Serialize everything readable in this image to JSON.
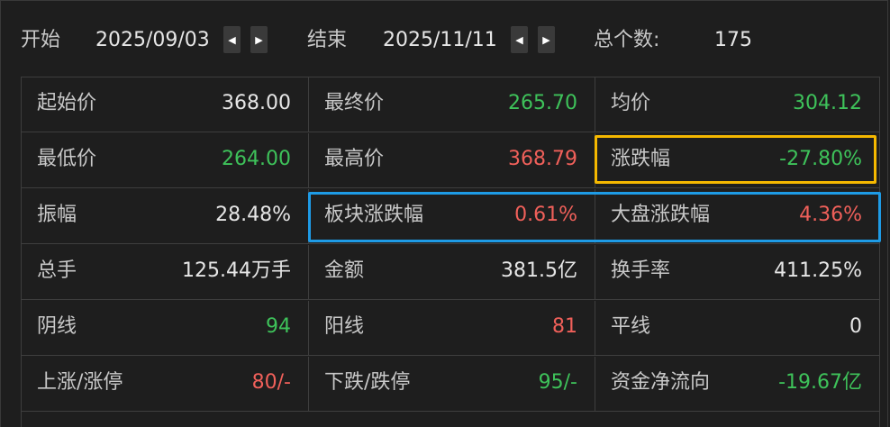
{
  "header": {
    "start_label": "开始",
    "start_date": "2025/09/03",
    "end_label": "结束",
    "end_date": "2025/11/11",
    "count_label": "总个数:",
    "count_value": "175",
    "prev_glyph": "◀",
    "next_glyph": "▶"
  },
  "stats": [
    [
      {
        "label": "起始价",
        "value": "368.00",
        "color": "white"
      },
      {
        "label": "最终价",
        "value": "265.70",
        "color": "green"
      },
      {
        "label": "均价",
        "value": "304.12",
        "color": "green"
      }
    ],
    [
      {
        "label": "最低价",
        "value": "264.00",
        "color": "green"
      },
      {
        "label": "最高价",
        "value": "368.79",
        "color": "red"
      },
      {
        "label": "涨跌幅",
        "value": "-27.80%",
        "color": "green"
      }
    ],
    [
      {
        "label": "振幅",
        "value": "28.48%",
        "color": "white"
      },
      {
        "label": "板块涨跌幅",
        "value": "0.61%",
        "color": "red"
      },
      {
        "label": "大盘涨跌幅",
        "value": "4.36%",
        "color": "red"
      }
    ],
    [
      {
        "label": "总手",
        "value": "125.44万手",
        "color": "white"
      },
      {
        "label": "金额",
        "value": "381.5亿",
        "color": "white"
      },
      {
        "label": "换手率",
        "value": "411.25%",
        "color": "white"
      }
    ],
    [
      {
        "label": "阴线",
        "value": "94",
        "color": "green"
      },
      {
        "label": "阳线",
        "value": "81",
        "color": "red"
      },
      {
        "label": "平线",
        "value": "0",
        "color": "white"
      }
    ],
    [
      {
        "label": "上涨/涨停",
        "value": "80/-",
        "color": "red"
      },
      {
        "label": "下跌/跌停",
        "value": "95/-",
        "color": "green"
      },
      {
        "label": "资金净流向",
        "value": "-19.67亿",
        "color": "green"
      }
    ]
  ],
  "colors": {
    "background": "#1e1e1e",
    "up_red": "#f0605a",
    "down_green": "#3ec25a",
    "highlight_yellow": "#f5b800",
    "highlight_blue": "#1e9be6"
  }
}
